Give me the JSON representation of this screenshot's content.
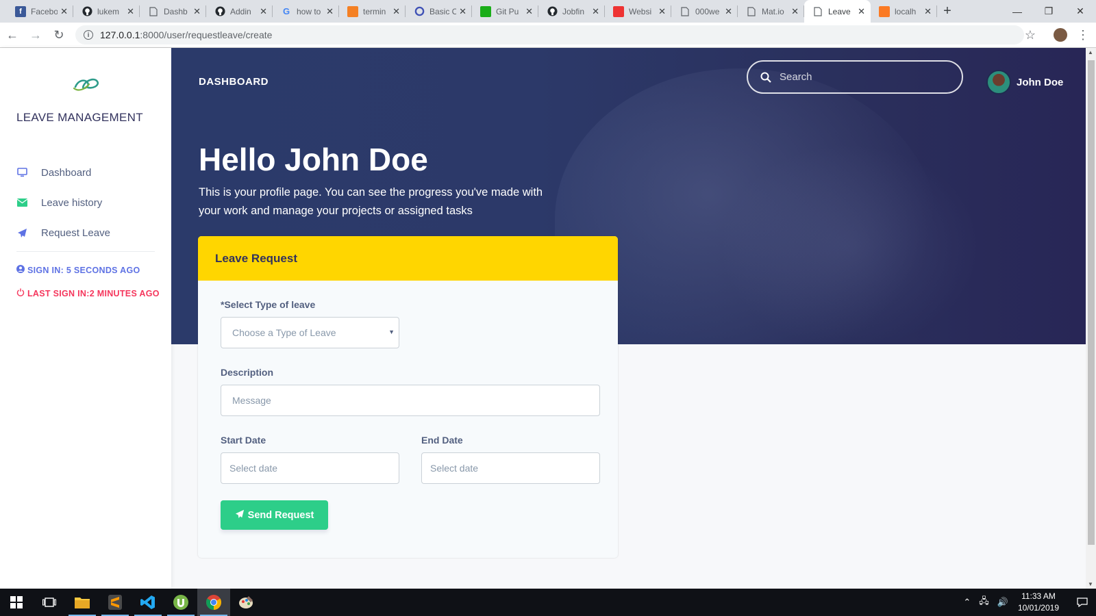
{
  "browser": {
    "tabs": [
      {
        "label": "Facebook",
        "icon": "facebook-icon",
        "color": "#3b5998"
      },
      {
        "label": "lukem",
        "icon": "github-icon",
        "color": "#24292e"
      },
      {
        "label": "Dashb",
        "icon": "page-icon",
        "color": "#5f6368"
      },
      {
        "label": "Addin",
        "icon": "github-icon",
        "color": "#24292e"
      },
      {
        "label": "how to",
        "icon": "google-icon",
        "color": "#4285f4"
      },
      {
        "label": "termin",
        "icon": "stackoverflow-icon",
        "color": "#f48024"
      },
      {
        "label": "Basic C",
        "icon": "circle-icon",
        "color": "#3f51b5"
      },
      {
        "label": "Git Pu",
        "icon": "gitpush-icon",
        "color": "#1aad19"
      },
      {
        "label": "Jobfin",
        "icon": "github-icon",
        "color": "#24292e"
      },
      {
        "label": "Websi",
        "icon": "website-icon",
        "color": "#e33"
      },
      {
        "label": "000we",
        "icon": "page-icon",
        "color": "#5f6368"
      },
      {
        "label": "Mat.io",
        "icon": "page-icon",
        "color": "#5f6368"
      },
      {
        "label": "Leave",
        "icon": "page-icon",
        "color": "#5f6368",
        "active": true
      },
      {
        "label": "localh",
        "icon": "xampp-icon",
        "color": "#fb7a24"
      }
    ],
    "url_host": "127.0.0.1",
    "url_path": ":8000/user/requestleave/create"
  },
  "sidebar": {
    "brand": "LEAVE MANAGEMENT",
    "items": [
      {
        "label": "Dashboard",
        "icon": "monitor-icon",
        "color": "#5e72e4"
      },
      {
        "label": "Leave history",
        "icon": "envelope-icon",
        "color": "#2dce89"
      },
      {
        "label": "Request Leave",
        "icon": "paper-plane-icon",
        "color": "#5e72e4"
      }
    ],
    "sign_in": "SIGN IN: 5 SECONDS AGO",
    "last_sign_in": "LAST SIGN IN:2 MINUTES AGO"
  },
  "header": {
    "title": "DASHBOARD",
    "search_placeholder": "Search",
    "username": "John Doe"
  },
  "hero": {
    "greeting": "Hello John Doe",
    "lead": "This is your profile page. You can see the progress you've made with your work and manage your projects or assigned tasks"
  },
  "form": {
    "title": "Leave Request",
    "type_label": "*Select Type of leave",
    "type_placeholder": "Choose a Type of Leave",
    "description_label": "Description",
    "description_placeholder": "Message",
    "start_label": "Start Date",
    "start_placeholder": "Select date",
    "end_label": "End Date",
    "end_placeholder": "Select date",
    "submit_label": "Send Request"
  },
  "taskbar": {
    "time": "11:33 AM",
    "date": "10/01/2019"
  },
  "colors": {
    "accent": "#5e72e4",
    "success": "#2dce89",
    "danger": "#f5365c",
    "warning": "#ffd600",
    "hero_bg": "#2b3a6a"
  }
}
